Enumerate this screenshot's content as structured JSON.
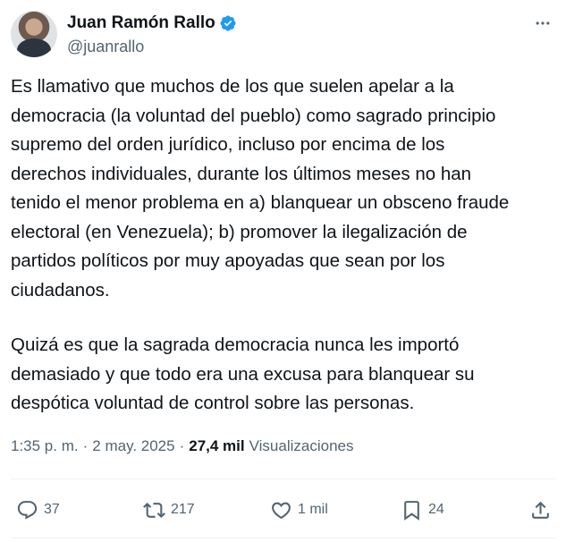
{
  "author": {
    "name": "Juan Ramón Rallo",
    "handle": "@juanrallo",
    "verified": true
  },
  "tweet": {
    "paragraph1": "Es llamativo que muchos de los que suelen apelar a la\ndemocracia (la voluntad del pueblo) como sagrado principio\nsupremo del orden jurídico, incluso por encima de los\nderechos individuales, durante los últimos meses no han\ntenido el menor problema en a) blanquear un obsceno fraude\nelectoral (en Venezuela); b) promover la ilegalización de\npartidos políticos por muy apoyadas que sean por los\nciudadanos.",
    "paragraph2": "Quizá es que la sagrada democracia nunca les importó\ndemasiado y que todo era una excusa para blanquear su\ndespótica voluntad de control sobre las personas."
  },
  "meta": {
    "time": "1:35 p. m.",
    "separator": "·",
    "date": "2 may. 2025",
    "views_count": "27,4 mil",
    "views_label": "Visualizaciones"
  },
  "actions": {
    "replies": "37",
    "reposts": "217",
    "likes": "1 mil",
    "bookmarks": "24"
  },
  "colors": {
    "text": "#0f1419",
    "secondary": "#536471",
    "verified_badge": "#1d9bf0",
    "divider": "#eff3f4"
  },
  "icons": [
    "verified-badge-icon",
    "more-icon",
    "reply-icon",
    "repost-icon",
    "like-icon",
    "bookmark-icon",
    "share-icon"
  ]
}
